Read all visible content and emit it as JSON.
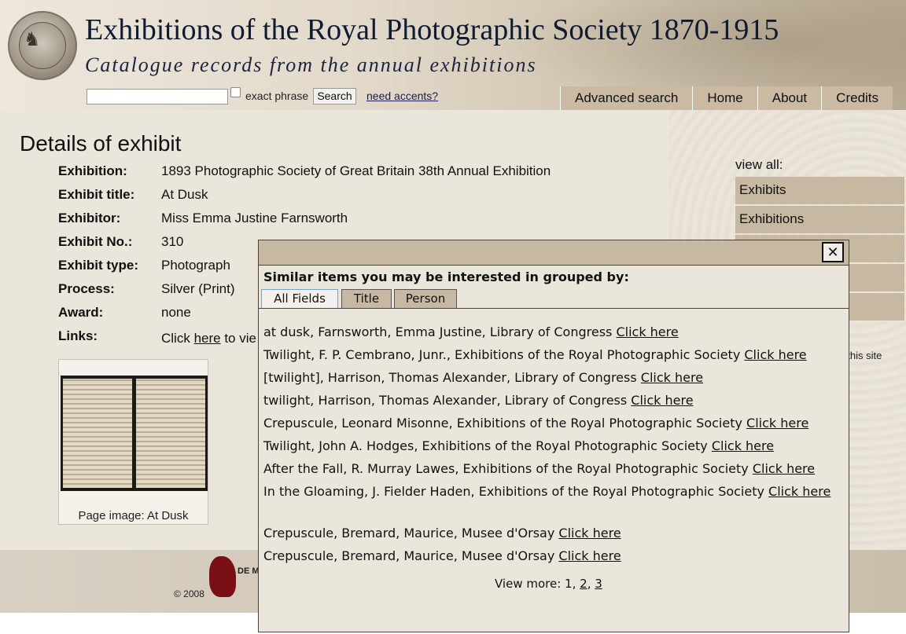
{
  "header": {
    "title": "Exhibitions of the Royal Photographic Society 1870-1915",
    "subtitle": "Catalogue records from the annual exhibitions",
    "search": {
      "value": "",
      "exact_label": "exact phrase",
      "button_label": "Search",
      "accents_link": "need accents?"
    },
    "nav": [
      "Advanced search",
      "Home",
      "About",
      "Credits"
    ]
  },
  "main": {
    "page_title": "Details of exhibit",
    "details": [
      {
        "label": "Exhibition:",
        "value": "1893 Photographic Society of Great Britain 38th Annual Exhibition"
      },
      {
        "label": "Exhibit title:",
        "value": "At Dusk"
      },
      {
        "label": "Exhibitor:",
        "value": "Miss Emma Justine Farnsworth"
      },
      {
        "label": "Exhibit No.:",
        "value": "310"
      },
      {
        "label": "Exhibit type:",
        "value": "Photograph"
      },
      {
        "label": "Process:",
        "value": "Silver (Print)"
      },
      {
        "label": "Award:",
        "value": "none"
      }
    ],
    "links": {
      "label": "Links:",
      "prefix": "Click ",
      "link": "here",
      "suffix": " to vie"
    },
    "thumbnail_caption": "Page image: At Dusk"
  },
  "sidebar": {
    "view_all": "view all:",
    "items": [
      "Exhibits",
      "Exhibitions",
      "",
      "",
      ""
    ],
    "site_note": "t this site"
  },
  "footer": {
    "copyright": "© 2008",
    "logo_text": "DE M UNI LEICE"
  },
  "modal": {
    "close": "✕",
    "heading": "Similar items you may be interested in grouped by:",
    "tabs": [
      "All Fields",
      "Title",
      "Person"
    ],
    "active_tab": "All Fields",
    "results": [
      {
        "text": "at dusk, Farnsworth, Emma Justine, Library of Congress ",
        "link": "Click here"
      },
      {
        "text": "Twilight, F. P. Cembrano, Junr., Exhibitions of the Royal Photographic Society ",
        "link": "Click here"
      },
      {
        "text": "[twilight], Harrison, Thomas Alexander, Library of Congress ",
        "link": "Click here"
      },
      {
        "text": "twilight, Harrison, Thomas Alexander, Library of Congress ",
        "link": "Click here"
      },
      {
        "text": "Crepuscule, Leonard Misonne, Exhibitions of the Royal Photographic Society ",
        "link": "Click here"
      },
      {
        "text": "Twilight, John A. Hodges, Exhibitions of the Royal Photographic Society ",
        "link": "Click here"
      },
      {
        "text": "After the Fall, R. Murray Lawes, Exhibitions of the Royal Photographic Society ",
        "link": "Click here"
      },
      {
        "text": "In the Gloaming, J. Fielder Haden, Exhibitions of the Royal Photographic Society ",
        "link": "Click here"
      },
      {
        "text": "Crepuscule, Bremard, Maurice, Musee d'Orsay ",
        "link": "Click here"
      },
      {
        "text": "Crepuscule, Bremard, Maurice, Musee d'Orsay ",
        "link": "Click here"
      }
    ],
    "view_more": {
      "label": "View more: ",
      "pages": [
        "1",
        "2",
        "3"
      ]
    }
  }
}
